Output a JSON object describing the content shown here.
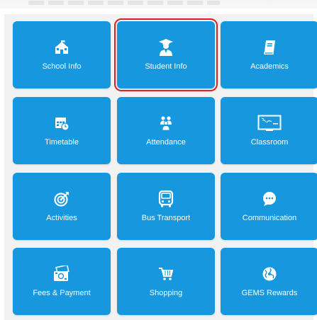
{
  "colors": {
    "tile": "#1697de",
    "selection": "#e0201f",
    "tile_text": "#ffffff",
    "background": "#f2f2f2"
  },
  "tiles": [
    {
      "label": "School Info",
      "icon": "school-icon",
      "selected": false
    },
    {
      "label": "Student Info",
      "icon": "graduate-student-icon",
      "selected": true
    },
    {
      "label": "Academics",
      "icon": "book-icon",
      "selected": false
    },
    {
      "label": "Timetable",
      "icon": "calendar-clock-icon",
      "selected": false
    },
    {
      "label": "Attendance",
      "icon": "people-group-icon",
      "selected": false
    },
    {
      "label": "Classroom",
      "icon": "chalkboard-icon",
      "selected": false
    },
    {
      "label": "Activities",
      "icon": "target-icon",
      "selected": false
    },
    {
      "label": "Bus Transport",
      "icon": "bus-icon",
      "selected": false
    },
    {
      "label": "Communication",
      "icon": "chat-bubble-icon",
      "selected": false
    },
    {
      "label": "Fees & Payment",
      "icon": "cash-payment-icon",
      "selected": false
    },
    {
      "label": "Shopping",
      "icon": "shopping-cart-icon",
      "selected": false
    },
    {
      "label": "GEMS Rewards",
      "icon": "globe-rewards-icon",
      "selected": false
    }
  ]
}
